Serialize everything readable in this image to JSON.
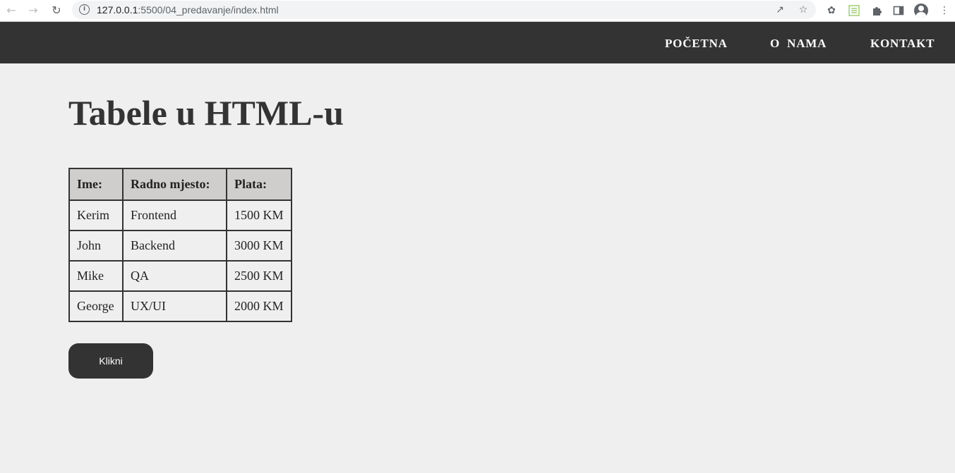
{
  "browser": {
    "url_host": "127.0.0.1",
    "url_path": ":5500/04_predavanje/index.html",
    "icons": [
      "back-icon",
      "forward-icon",
      "reload-icon",
      "info-icon",
      "share-icon",
      "star-icon",
      "bug-extension-icon",
      "sheet-extension-icon",
      "puzzle-extension-icon",
      "sidepanel-icon",
      "profile-icon",
      "menu-kebab-icon"
    ]
  },
  "header": {
    "nav": {
      "home": "POČETNA",
      "about": "O  NAMA",
      "contact": "KONTAKT"
    }
  },
  "main": {
    "title": "Tabele u HTML-u",
    "table": {
      "headers": [
        "Ime:",
        "Radno mjesto:",
        "Plata:"
      ],
      "rows": [
        [
          "Kerim",
          "Frontend",
          "1500 KM"
        ],
        [
          "John",
          "Backend",
          "3000 KM"
        ],
        [
          "Mike",
          "QA",
          "2500 KM"
        ],
        [
          "George",
          "UX/UI",
          "2000 KM"
        ]
      ]
    },
    "button_label": "Klikni"
  },
  "colors": {
    "header_bg": "#333333",
    "page_bg": "#efefef",
    "table_header_bg": "#d0cdcd",
    "button_bg": "#333333"
  }
}
